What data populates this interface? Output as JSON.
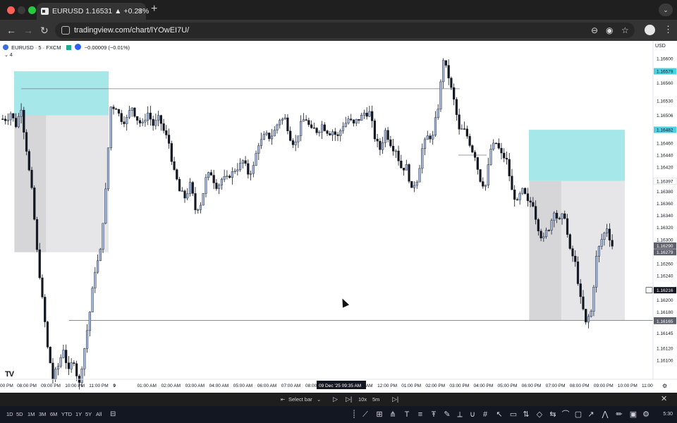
{
  "browser": {
    "tab_title": "EURUSD 1.16531 ▲ +0.23%",
    "tab_close": "×",
    "new_tab": "+",
    "tab_menu": "⌄",
    "url": "tradingview.com/chart/lYOwEI7U/",
    "back": "←",
    "forward": "→",
    "reload": "↻",
    "zoom_icon": "⊖",
    "eye_icon": "◉",
    "star_icon": "☆",
    "menu_icon": "⋮"
  },
  "chart": {
    "symbol": "EURUSD · 5 · FXCM",
    "change": "−0.00009 (−0.01%)",
    "indicator_row": "⌄ 4",
    "currency": "USD",
    "logo": "TV",
    "price_axis": {
      "min": 1.1608,
      "max": 1.1662,
      "ticks": [
        "1.16600",
        "1.16560",
        "1.16530",
        "1.16506",
        "1.16460",
        "1.16440",
        "1.16420",
        "1.16380",
        "1.16360",
        "1.16340",
        "1.16320",
        "1.16300",
        "1.16260",
        "1.16240",
        "1.16200",
        "1.16180",
        "1.16145",
        "1.16120",
        "1.16100"
      ],
      "labels": [
        {
          "value": 1.16579,
          "text": "1.16579",
          "bg": "#4dd0e1",
          "fg": "#131722"
        },
        {
          "value": 1.16482,
          "text": "1.16482",
          "bg": "#4dd0e1",
          "fg": "#131722"
        },
        {
          "value": 1.16397,
          "text": "1.16397",
          "bg": "#ffffff",
          "fg": "#131722"
        },
        {
          "value": 1.1629,
          "text": "1.16290",
          "bg": "#5d606b",
          "fg": "#ffffff"
        },
        {
          "value": 1.16279,
          "text": "1.16279",
          "bg": "#5d606b",
          "fg": "#ffffff"
        },
        {
          "value": 1.16216,
          "text": "1.16216",
          "bg": "#131722",
          "fg": "#ffffff"
        },
        {
          "value": 1.16166,
          "text": "1.16166",
          "bg": "#5d606b",
          "fg": "#ffffff"
        },
        {
          "value": 1.16165,
          "text": "1.16165",
          "bg": "#5d606b",
          "fg": "#ffffff"
        }
      ]
    },
    "time_axis": {
      "labels": [
        "00 PM",
        "08:00 PM",
        "09:00 PM",
        "10:00 PM",
        "11:00 PM",
        "9",
        "01:00 AM",
        "02:00 AM",
        "03:00 AM",
        "04:00 AM",
        "05:00 AM",
        "06:00 AM",
        "07:00 AM",
        "08:00 AM",
        "",
        "10:00 AM",
        "12:00 PM",
        "01:00 PM",
        "02:00 PM",
        "03:00 PM",
        "04:00 PM",
        "05:00 PM",
        "06:00 PM",
        "07:00 PM",
        "08:00 PM",
        "09:00 PM",
        "10:00 PM",
        "11:00"
      ],
      "crosshair_label": "09 Dec '25  09:35 AM"
    }
  },
  "bottom_bar": {
    "select_bar": "Select bar",
    "speed": "10x",
    "interval": "5m",
    "close": "✕"
  },
  "status_bar": {
    "timeframes": [
      "1D",
      "5D",
      "1M",
      "3M",
      "6M",
      "YTD",
      "1Y",
      "5Y",
      "All"
    ],
    "time": "5:30"
  },
  "chart_data": {
    "type": "candlestick",
    "ylim": [
      1.1608,
      1.1662
    ],
    "positions": [
      {
        "label": "long-position-left",
        "target_top": 1.16579,
        "entry": 1.16506,
        "stop": 1.16279
      },
      {
        "label": "long-position-right",
        "target_top": 1.16482,
        "entry": 1.16397,
        "stop": 1.16166
      }
    ],
    "horizontal_lines": [
      {
        "value": 1.1655,
        "name": "swing-high-line"
      },
      {
        "value": 1.16166,
        "name": "swing-low-line"
      }
    ],
    "path": [
      1.165,
      1.1651,
      1.1649,
      1.1652,
      1.1645,
      1.1638,
      1.1628,
      1.162,
      1.1612,
      1.1607,
      1.1609,
      1.1612,
      1.1608,
      1.161,
      1.1606,
      1.1612,
      1.1618,
      1.1625,
      1.1628,
      1.1638,
      1.1652,
      1.1652,
      1.165,
      1.165,
      1.1652,
      1.165,
      1.1649,
      1.1651,
      1.1649,
      1.165,
      1.1648,
      1.1646,
      1.1641,
      1.1638,
      1.1637,
      1.1639,
      1.1635,
      1.1636,
      1.164,
      1.1641,
      1.1639,
      1.164,
      1.164,
      1.1641,
      1.1642,
      1.1643,
      1.1641,
      1.1642,
      1.1646,
      1.1647,
      1.1647,
      1.1648,
      1.165,
      1.165,
      1.1647,
      1.1646,
      1.1649,
      1.165,
      1.1648,
      1.1648,
      1.1649,
      1.1648,
      1.1648,
      1.1647,
      1.1649,
      1.165,
      1.1649,
      1.165,
      1.1651,
      1.1651,
      1.1647,
      1.1645,
      1.1648,
      1.1646,
      1.1645,
      1.1642,
      1.1642,
      1.1638,
      1.164,
      1.1645,
      1.1647,
      1.1647,
      1.1652,
      1.166,
      1.1657,
      1.1653,
      1.1648,
      1.1648,
      1.1646,
      1.1644,
      1.164,
      1.1639,
      1.1645,
      1.1646,
      1.1644,
      1.1643,
      1.1638,
      1.1636,
      1.1638,
      1.1636,
      1.1636,
      1.1632,
      1.163,
      1.1632,
      1.1635,
      1.1633,
      1.1634,
      1.1628,
      1.1626,
      1.162,
      1.1616,
      1.1618,
      1.1627,
      1.163,
      1.1632,
      1.1629
    ]
  }
}
